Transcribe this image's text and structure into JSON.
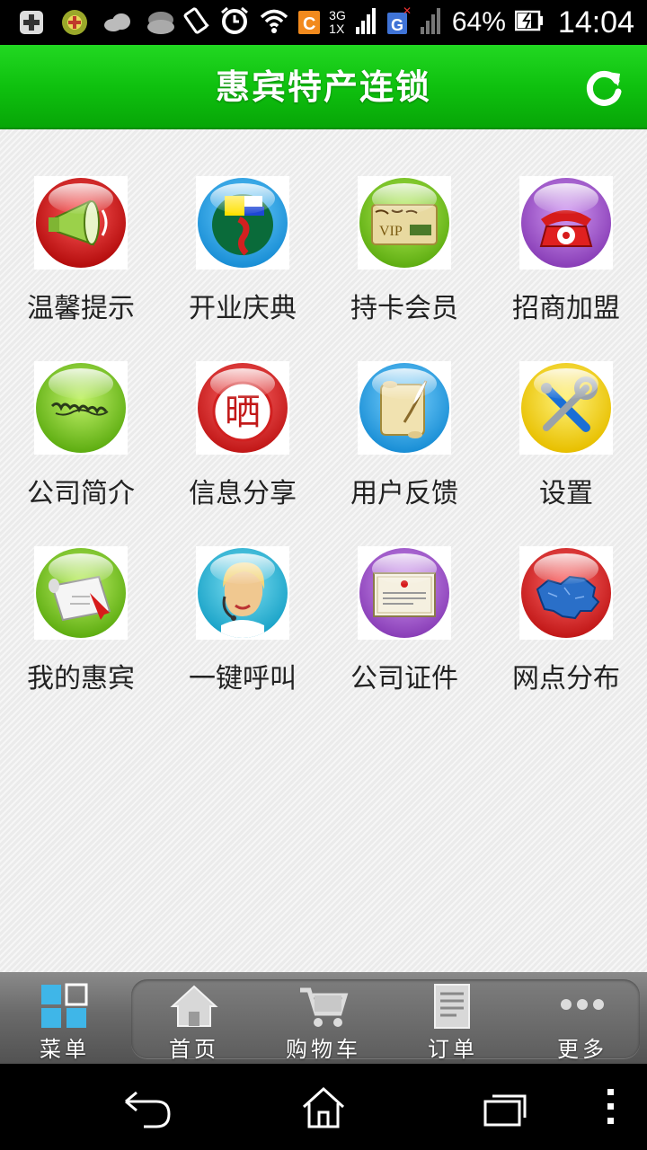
{
  "status_bar": {
    "battery_text": "64%",
    "time": "14:04",
    "network_3g": "3G",
    "network_1x": "1X",
    "icons": [
      "add-icon",
      "game-icon",
      "cloud-icon",
      "weather-icon",
      "vibrate-icon",
      "alarm-icon",
      "wifi-icon",
      "c-app-icon",
      "signal-icon",
      "g-app-icon",
      "signal-icon",
      "battery-icon"
    ]
  },
  "header": {
    "title": "惠宾特产连锁",
    "refresh_icon": "refresh-icon",
    "colors": {
      "bar": "#13c313",
      "text": "#ffffff"
    }
  },
  "grid": {
    "items": [
      {
        "label": "温馨提示",
        "icon": "megaphone-icon",
        "color": "#d61e1e"
      },
      {
        "label": "开业庆典",
        "icon": "opening-logo-icon",
        "color": "#1aa3e0"
      },
      {
        "label": "持卡会员",
        "icon": "vip-card-icon",
        "color": "#6cbf1c",
        "card_text": "VIP"
      },
      {
        "label": "招商加盟",
        "icon": "telephone-icon",
        "color": "#8a3fb8"
      },
      {
        "label": "公司简介",
        "icon": "company-brand-icon",
        "color": "#6cbf1c"
      },
      {
        "label": "信息分享",
        "icon": "share-stamp-icon",
        "color": "#d61e1e",
        "stamp_text": "晒"
      },
      {
        "label": "用户反馈",
        "icon": "scroll-quill-icon",
        "color": "#1a8fd6"
      },
      {
        "label": "设置",
        "icon": "tools-icon",
        "color": "#e8c000"
      },
      {
        "label": "我的惠宾",
        "icon": "diploma-icon",
        "color": "#6cbf1c"
      },
      {
        "label": "一键呼叫",
        "icon": "call-center-icon",
        "color": "#1aa3c8"
      },
      {
        "label": "公司证件",
        "icon": "certificate-icon",
        "color": "#8a3fb8"
      },
      {
        "label": "网点分布",
        "icon": "china-map-icon",
        "color": "#d61e1e"
      }
    ]
  },
  "tab_bar": {
    "tabs": [
      {
        "label": "菜单",
        "icon": "menu-grid-icon"
      },
      {
        "label": "首页",
        "icon": "home-icon"
      },
      {
        "label": "购物车",
        "icon": "shopping-cart-icon"
      },
      {
        "label": "订单",
        "icon": "order-icon"
      },
      {
        "label": "更多",
        "icon": "more-icon"
      }
    ]
  },
  "nav_bar": {
    "buttons": [
      "back-icon",
      "home-nav-icon",
      "recent-apps-icon",
      "overflow-menu-icon"
    ]
  }
}
